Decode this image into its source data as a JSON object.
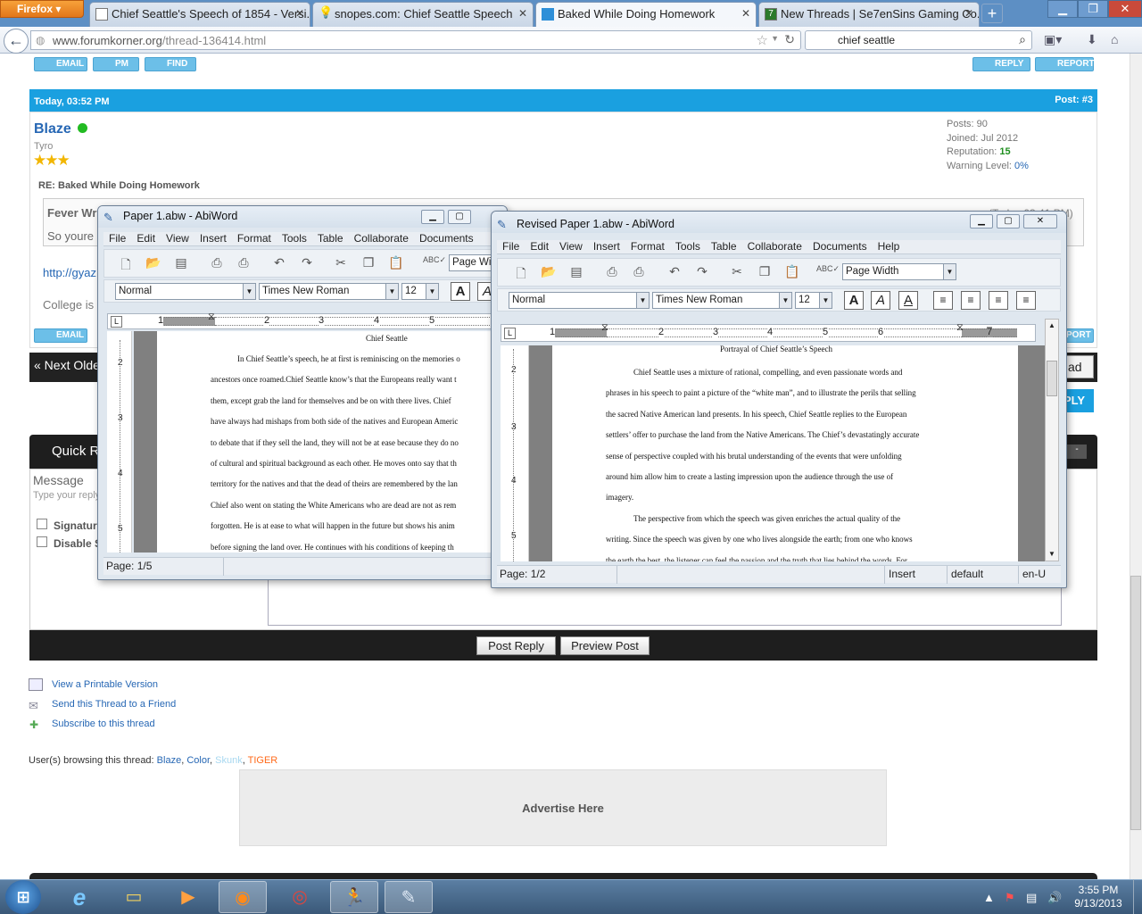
{
  "browser": {
    "menu_label": "Firefox",
    "tabs": [
      {
        "label": "Chief Seattle's Speech of 1854 - Versi...",
        "icon": "page-icon",
        "active": false
      },
      {
        "label": "snopes.com: Chief Seattle Speech",
        "icon": "lightbulb-icon",
        "active": false
      },
      {
        "label": "Baked While Doing Homework",
        "icon": "forum-icon",
        "active": true
      },
      {
        "label": "New Threads | Se7enSins Gaming Co...",
        "icon": "seven-icon",
        "active": false
      }
    ],
    "url_host": "www.forumkorner.org",
    "url_path": "/thread-136414.html",
    "search_query": "chief seattle",
    "new_tab": "+"
  },
  "forum": {
    "buttons_top": {
      "email": "EMAIL",
      "pm": "PM",
      "find": "FIND",
      "reply": "REPLY",
      "report": "REPORT"
    },
    "post": {
      "date": "Today, 03:52 PM",
      "number": "Post: #3",
      "author": "Blaze",
      "rank": "Tyro",
      "stats": {
        "posts_label": "Posts:",
        "posts": "90",
        "joined_label": "Joined:",
        "joined": "Jul 2012",
        "rep_label": "Reputation:",
        "rep": "15",
        "warn_label": "Warning Level:",
        "warn": "0%"
      },
      "subject": "RE: Baked While Doing Homework",
      "quote_author": "Fever Wr",
      "quote_text": "So youre",
      "quote_time": "(Today 03:41 PM)",
      "link_text": "http://gyaz",
      "signature": "College is"
    },
    "buttons_bottom": {
      "email": "EMAIL",
      "report": "PORT"
    },
    "nav_prev": "« Next Olde",
    "nav_next": "ad",
    "reply_btn": "PLY",
    "quick_reply": {
      "title": "Quick R",
      "message_label": "Message",
      "message_hint": "Type your reply",
      "sig_label": "Signature",
      "disable_label": "Disable S",
      "post_reply": "Post Reply",
      "preview_post": "Preview Post"
    },
    "thread_tools": [
      {
        "label": "View a Printable Version",
        "icon": "printer-icon"
      },
      {
        "label": "Send this Thread to a Friend",
        "icon": "envelope-icon"
      },
      {
        "label": "Subscribe to this thread",
        "icon": "subscribe-icon"
      }
    ],
    "browsing_label": "User(s) browsing this thread:",
    "browsing_users": [
      {
        "name": "Blaze",
        "color": "#2667b4"
      },
      {
        "name": "Color",
        "color": "#2667b4"
      },
      {
        "name": "Skunk",
        "color": "#a8d8f0"
      },
      {
        "name": "TIGER",
        "color": "#ff6a1a"
      }
    ],
    "advert": "Advertise Here"
  },
  "abiword_left": {
    "title": "Paper 1.abw - AbiWord",
    "menu": [
      "File",
      "Edit",
      "View",
      "Insert",
      "Format",
      "Tools",
      "Table",
      "Collaborate",
      "Documents"
    ],
    "zoom": "Page Wid",
    "style": "Normal",
    "font": "Times New Roman",
    "size": "12",
    "doc_title": "Chief Seattle",
    "lines": [
      "In Chief Seattle’s speech, he at first is reminiscing on the memories o",
      "ancestors once roamed.Chief Seattle know’s that the Europeans really want t",
      "them, except grab the land for themselves and be on with there lives. Chief",
      "have always had mishaps from both side of the natives and European Americ",
      "to debate that if they sell the land, they will not be at ease because they do no",
      "of cultural and spiritual background as each other. He moves onto say that th",
      "territory for the natives and that the dead of theirs are remembered by the lan",
      "Chief also went on stating the White Americans who are dead are not as rem",
      "forgotten. He is at ease to what will happen in the future but shows his anim",
      "before signing the land over. He continues with his conditions of keeping th"
    ],
    "page_status": "Page: 1/5",
    "ruler_nums": [
      "1",
      "2",
      "3",
      "4",
      "5"
    ]
  },
  "abiword_right": {
    "title": "Revised Paper 1.abw - AbiWord",
    "menu": [
      "File",
      "Edit",
      "View",
      "Insert",
      "Format",
      "Tools",
      "Table",
      "Collaborate",
      "Documents",
      "Help"
    ],
    "zoom": "Page Width",
    "style": "Normal",
    "font": "Times New Roman",
    "size": "12",
    "doc_title": "Portrayal of Chief Seattle’s Speech",
    "lines": [
      "Chief Seattle uses a mixture of rational, compelling, and even passionate words and",
      "phrases in his speech to paint a picture of the “white man”, and to illustrate the perils that selling",
      "the sacred Native American land presents. In his speech, Chief Seattle replies to the European",
      "settlers’ offer to purchase the land from the Native Americans. The Chief’s devastatingly accurate",
      "sense of perspective coupled with his brutal understanding of the events that were unfolding",
      "around him allow him to create a lasting impression upon the audience through the use of",
      "imagery.",
      "The perspective from which the speech was given enriches the actual quality of the",
      "writing. Since the speech was given by one who lives alongside the earth; from one who knows",
      "the earth the best, the listener can feel the passion and the truth that lies behind the words. For"
    ],
    "page_status": "Page: 1/2",
    "mode": "Insert",
    "lang_set": "default",
    "locale": "en-U",
    "ruler_nums": [
      "1",
      "2",
      "3",
      "4",
      "5",
      "6",
      "7"
    ]
  },
  "taskbar": {
    "time": "3:55 PM",
    "date": "9/13/2013",
    "apps": [
      "ie-icon",
      "explorer-icon",
      "media-player-icon",
      "firefox-icon",
      "chrome-icon",
      "aim-icon",
      "abiword-icon"
    ]
  }
}
